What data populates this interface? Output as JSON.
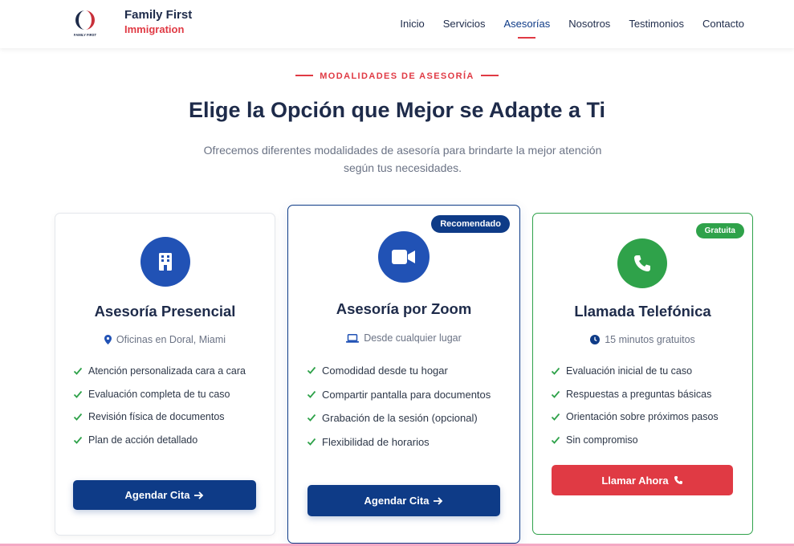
{
  "brand": {
    "name_top": "Family First",
    "name_bottom": "Immigration",
    "logo_text": "FAMILY FIRST"
  },
  "nav": {
    "items": [
      {
        "label": "Inicio"
      },
      {
        "label": "Servicios"
      },
      {
        "label": "Asesorías",
        "active": true
      },
      {
        "label": "Nosotros"
      },
      {
        "label": "Testimonios"
      },
      {
        "label": "Contacto"
      }
    ]
  },
  "section": {
    "eyebrow": "MODALIDADES DE ASESORÍA",
    "title": "Elige la Opción que Mejor se Adapte a Ti",
    "subtitle": "Ofrecemos diferentes modalidades de asesoría para brindarte la mejor atención según tus necesidades."
  },
  "cards": [
    {
      "icon": "building-icon",
      "title": "Asesoría Presencial",
      "subtitle": "Oficinas en Doral, Miami",
      "subtitle_icon": "map-pin-icon",
      "features": [
        "Atención personalizada cara a cara",
        "Evaluación completa de tu caso",
        "Revisión física de documentos",
        "Plan de acción detallado"
      ],
      "button": "Agendar Cita"
    },
    {
      "badge": "Recomendado",
      "icon": "video-icon",
      "title": "Asesoría por Zoom",
      "subtitle": "Desde cualquier lugar",
      "subtitle_icon": "laptop-icon",
      "features": [
        "Comodidad desde tu hogar",
        "Compartir pantalla para documentos",
        "Grabación de la sesión (opcional)",
        "Flexibilidad de horarios"
      ],
      "button": "Agendar Cita"
    },
    {
      "badge": "Gratuita",
      "icon": "phone-icon",
      "title": "Llamada Telefónica",
      "subtitle": "15 minutos gratuitos",
      "subtitle_icon": "clock-icon",
      "features": [
        "Evaluación inicial de tu caso",
        "Respuestas a preguntas básicas",
        "Orientación sobre próximos pasos",
        "Sin compromiso"
      ],
      "button": "Llamar Ahora"
    }
  ],
  "colors": {
    "navy": "#1e2b4a",
    "primary_blue": "#0e3b87",
    "icon_blue": "#2152b5",
    "accent_red": "#e03a44",
    "green": "#2fa24a"
  }
}
